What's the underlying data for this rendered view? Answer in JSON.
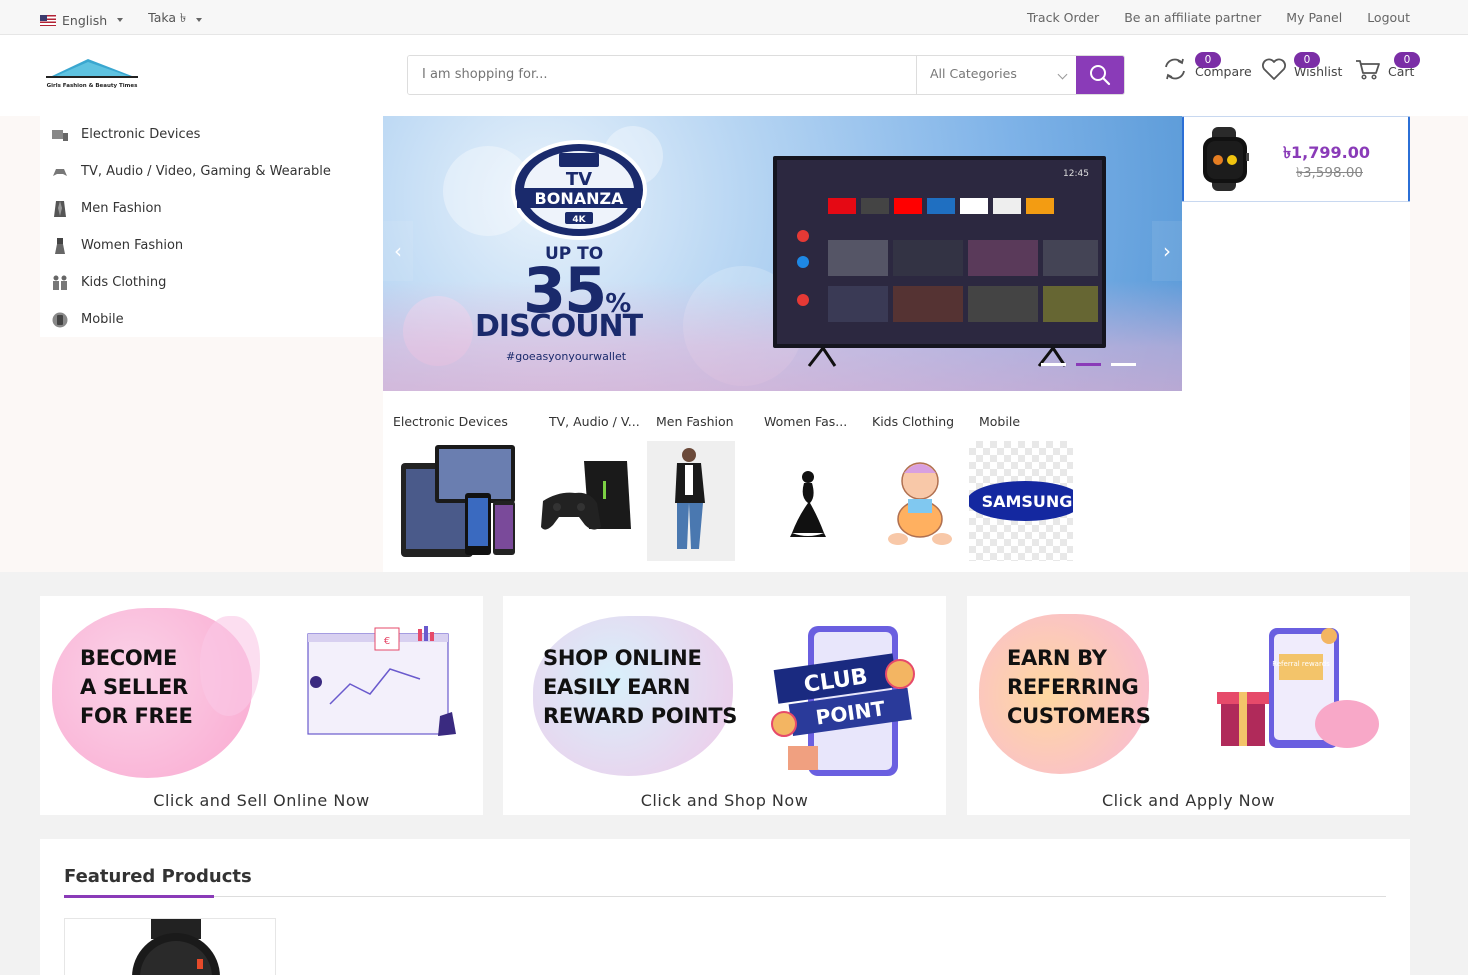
{
  "topbar": {
    "language": "English",
    "currency": "Taka ৳",
    "links": [
      "Track Order",
      "Be an affiliate partner",
      "My Panel",
      "Logout"
    ]
  },
  "header": {
    "logo_text": "Girls Fashion & Beauty Times",
    "search_placeholder": "I am shopping for...",
    "category_select": "All Categories",
    "compare": {
      "label": "Compare",
      "count": "0"
    },
    "wishlist": {
      "label": "Wishlist",
      "count": "0"
    },
    "cart": {
      "label": "Cart",
      "count": "0"
    }
  },
  "sidebar": {
    "items": [
      {
        "label": "Electronic Devices",
        "icon": "electronics-icon"
      },
      {
        "label": "TV, Audio / Video, Gaming & Wearable",
        "icon": "gaming-icon"
      },
      {
        "label": "Men Fashion",
        "icon": "men-fashion-icon"
      },
      {
        "label": "Women Fashion",
        "icon": "women-fashion-icon"
      },
      {
        "label": "Kids Clothing",
        "icon": "kids-icon"
      },
      {
        "label": "Mobile",
        "icon": "mobile-icon"
      }
    ]
  },
  "slider": {
    "badge_top": "TV",
    "badge_main": "BONANZA",
    "badge_sub": "4K",
    "up_to": "UP TO",
    "percent": "35",
    "percent_sign": "%",
    "discount": "DISCOUNT",
    "hashtag": "#goeasyonyourwallet",
    "tv_time": "12:45",
    "active_slide": 2,
    "slide_count": 3
  },
  "mini_product": {
    "price": "৳1,799.00",
    "old_price": "৳3,598.00"
  },
  "category_tiles": [
    {
      "label": "Electronic Devices"
    },
    {
      "label": "TV, Audio / V..."
    },
    {
      "label": "Men Fashion"
    },
    {
      "label": "Women Fas..."
    },
    {
      "label": "Kids Clothing"
    },
    {
      "label": "Mobile",
      "brand": "SAMSUNG"
    }
  ],
  "promos": [
    {
      "lines": [
        "BECOME",
        "A SELLER",
        "FOR FREE"
      ],
      "cta": "Click and Sell Online Now"
    },
    {
      "lines": [
        "SHOP ONLINE",
        "EASILY EARN",
        "REWARD POINTS"
      ],
      "cta": "Click and Shop Now",
      "ribbon_1": "CLUB",
      "ribbon_2": "POINT"
    },
    {
      "lines": [
        "EARN BY",
        "REFERRING",
        "CUSTOMERS"
      ],
      "cta": "Click and Apply Now",
      "phone_text": "Referral rewards"
    }
  ],
  "featured": {
    "title": "Featured Products"
  },
  "colors": {
    "accent": "#8a3bb8",
    "badge": "#7b2ea6"
  }
}
